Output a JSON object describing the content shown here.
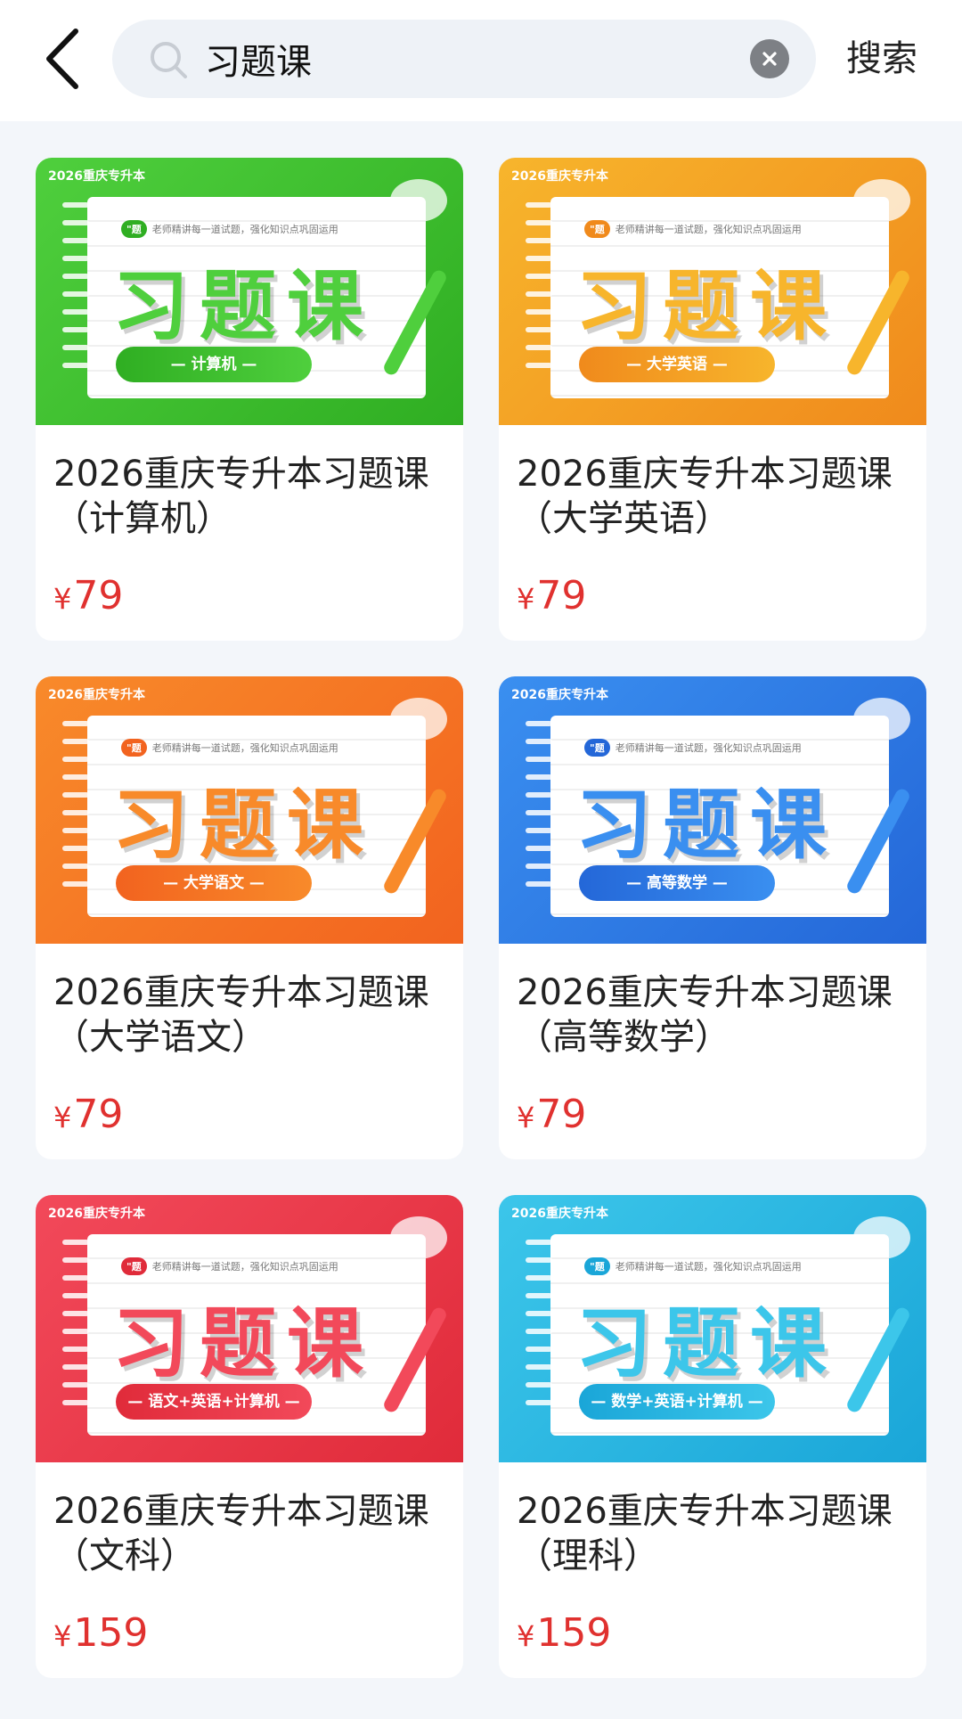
{
  "search": {
    "query": "习题课",
    "submit_label": "搜索"
  },
  "brand_text": "2026重庆专升本",
  "cover_tagline": "老师精讲每一道试题，强化知识点巩固运用",
  "cover_tag": "\"题",
  "products": [
    {
      "cover_title": "习题课",
      "cover_subject": "— 计算机 —",
      "title_line1": "2026重庆专升本习题课",
      "title_line2": "（计算机）",
      "price_symbol": "¥",
      "price": "79",
      "theme": "#4fcf3d",
      "theme_dark": "#2fae22"
    },
    {
      "cover_title": "习题课",
      "cover_subject": "— 大学英语 —",
      "title_line1": "2026重庆专升本习题课",
      "title_line2": "（大学英语）",
      "price_symbol": "¥",
      "price": "79",
      "theme": "#f7b52c",
      "theme_dark": "#f08a1c"
    },
    {
      "cover_title": "习题课",
      "cover_subject": "— 大学语文 —",
      "title_line1": "2026重庆专升本习题课",
      "title_line2": "（大学语文）",
      "price_symbol": "¥",
      "price": "79",
      "theme": "#f88a2a",
      "theme_dark": "#f2631f"
    },
    {
      "cover_title": "习题课",
      "cover_subject": "— 高等数学 —",
      "title_line1": "2026重庆专升本习题课",
      "title_line2": "（高等数学）",
      "price_symbol": "¥",
      "price": "79",
      "theme": "#3a8ff0",
      "theme_dark": "#2467d8"
    },
    {
      "cover_title": "习题课",
      "cover_subject": "— 语文+英语+计算机 —",
      "title_line1": "2026重庆专升本习题课",
      "title_line2": "（文科）",
      "price_symbol": "¥",
      "price": "159",
      "theme": "#f2495a",
      "theme_dark": "#e02b3a"
    },
    {
      "cover_title": "习题课",
      "cover_subject": "— 数学+英语+计算机 —",
      "title_line1": "2026重庆专升本习题课",
      "title_line2": "（理科）",
      "price_symbol": "¥",
      "price": "159",
      "theme": "#3cc6ea",
      "theme_dark": "#1aa6d8"
    }
  ]
}
